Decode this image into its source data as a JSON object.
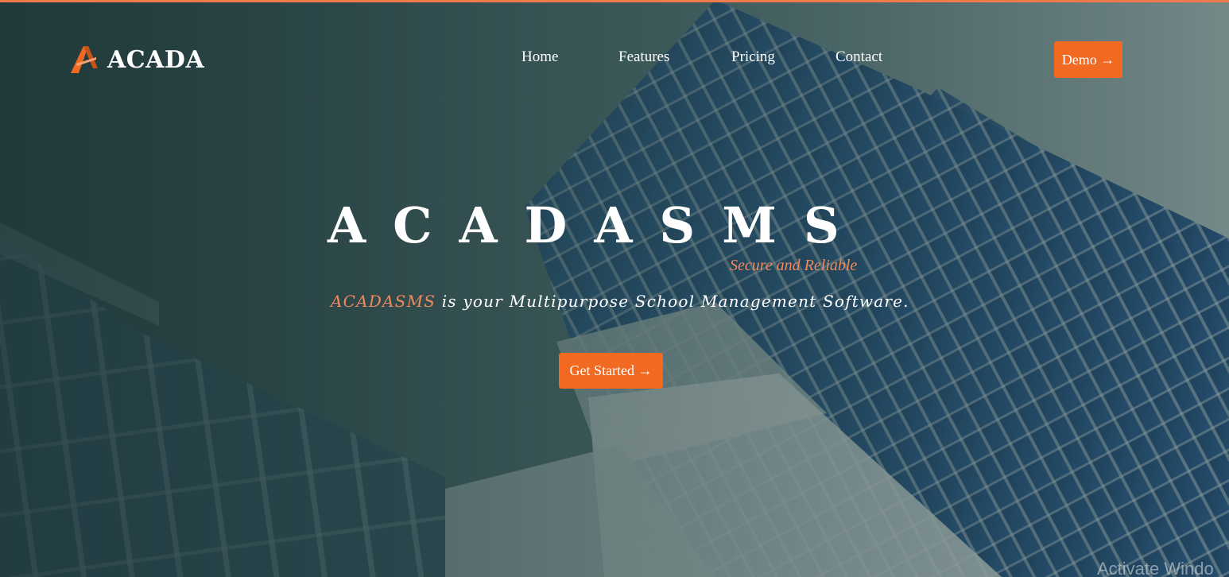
{
  "brand": {
    "name": "ACADA",
    "accent_color": "#f26a22",
    "logo_icon": "acada-a-logo-icon"
  },
  "nav": {
    "items": [
      {
        "label": "Home"
      },
      {
        "label": "Features"
      },
      {
        "label": "Pricing"
      },
      {
        "label": "Contact"
      }
    ],
    "demo_label": "Demo →"
  },
  "hero": {
    "title": "ACADASMS",
    "tagline": "Secure and Reliable",
    "subtitle_highlight": "ACADASMS",
    "subtitle_rest": " is your Multipurpose School Management Software.",
    "cta_label": "Get Started →",
    "background": "office-building-photo"
  },
  "system": {
    "watermark": "Activate Windo"
  },
  "colors": {
    "top_strip": "#ef7a4e",
    "highlight_text": "#f08a5d",
    "button": "#f26a22"
  }
}
